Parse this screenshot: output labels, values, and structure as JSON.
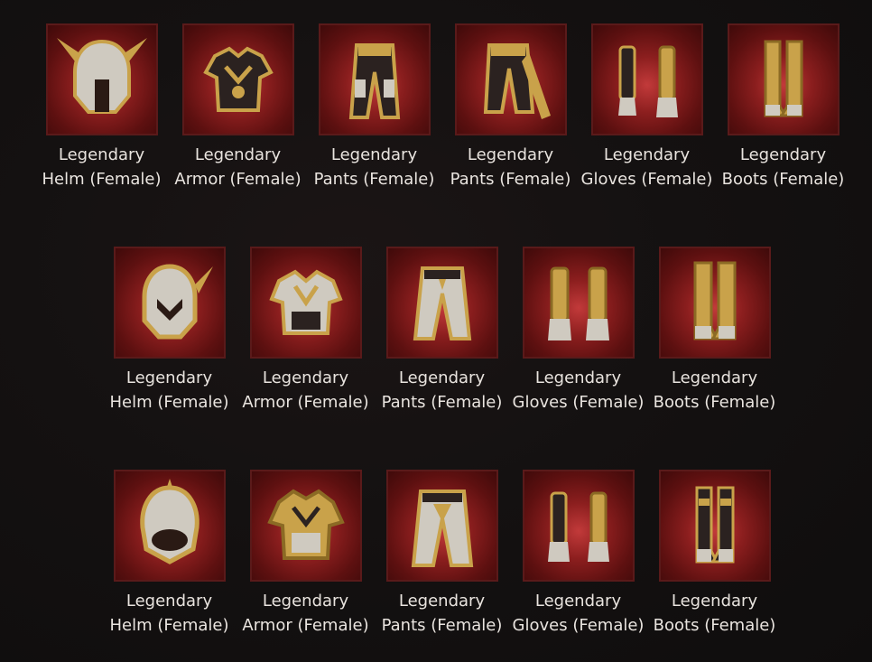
{
  "rows": [
    [
      {
        "line1": "Legendary",
        "line2": "Helm (Female)",
        "icon": "helm-icon"
      },
      {
        "line1": "Legendary",
        "line2": "Armor (Female)",
        "icon": "armor-icon"
      },
      {
        "line1": "Legendary",
        "line2": "Pants (Female)",
        "icon": "pants-icon"
      },
      {
        "line1": "Legendary",
        "line2": "Pants (Female)",
        "icon": "pants-icon"
      },
      {
        "line1": "Legendary",
        "line2": "Gloves (Female)",
        "icon": "gloves-icon"
      },
      {
        "line1": "Legendary",
        "line2": "Boots (Female)",
        "icon": "boots-icon"
      }
    ],
    [
      {
        "line1": "Legendary",
        "line2": "Helm (Female)",
        "icon": "helm-icon"
      },
      {
        "line1": "Legendary",
        "line2": "Armor (Female)",
        "icon": "armor-icon"
      },
      {
        "line1": "Legendary",
        "line2": "Pants (Female)",
        "icon": "pants-icon"
      },
      {
        "line1": "Legendary",
        "line2": "Gloves (Female)",
        "icon": "gloves-icon"
      },
      {
        "line1": "Legendary",
        "line2": "Boots (Female)",
        "icon": "boots-icon"
      }
    ],
    [
      {
        "line1": "Legendary",
        "line2": "Helm (Female)",
        "icon": "helm-icon"
      },
      {
        "line1": "Legendary",
        "line2": "Armor (Female)",
        "icon": "armor-icon"
      },
      {
        "line1": "Legendary",
        "line2": "Pants (Female)",
        "icon": "pants-icon"
      },
      {
        "line1": "Legendary",
        "line2": "Gloves (Female)",
        "icon": "gloves-icon"
      },
      {
        "line1": "Legendary",
        "line2": "Boots (Female)",
        "icon": "boots-icon"
      }
    ]
  ],
  "colors": {
    "label_text": "#e9e4df",
    "icon_border": "#5a1a1a",
    "gold": "#c9a24a",
    "silver": "#cfcac0",
    "page_background": "#141111"
  }
}
